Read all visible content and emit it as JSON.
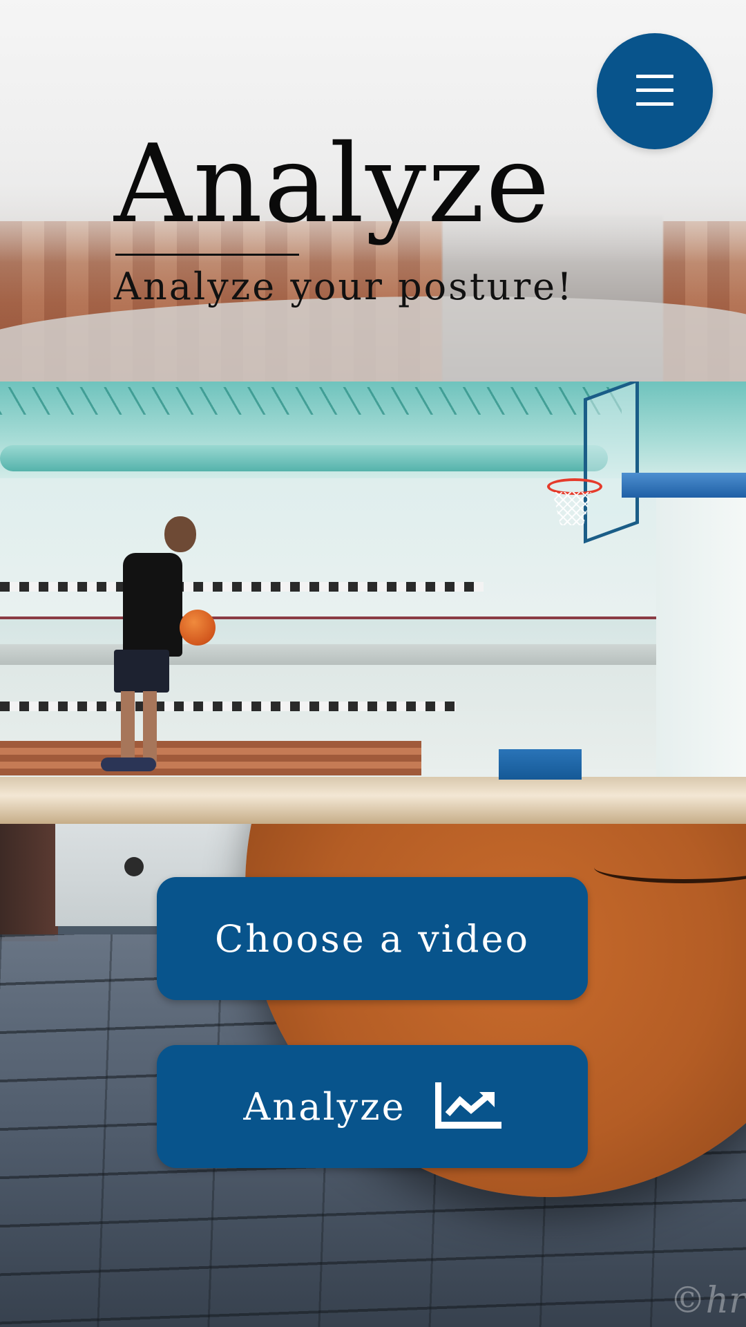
{
  "header": {
    "title": "Analyze",
    "subtitle": "Analyze your posture!",
    "menu_icon": "hamburger-menu-icon"
  },
  "actions": {
    "choose_video_label": "Choose a video",
    "analyze_label": "Analyze",
    "analyze_icon": "trend-chart-icon"
  },
  "watermark": "©hr",
  "colors": {
    "primary": "#08548c",
    "button_text": "#ffffff",
    "title_text": "#0a0a0a"
  }
}
